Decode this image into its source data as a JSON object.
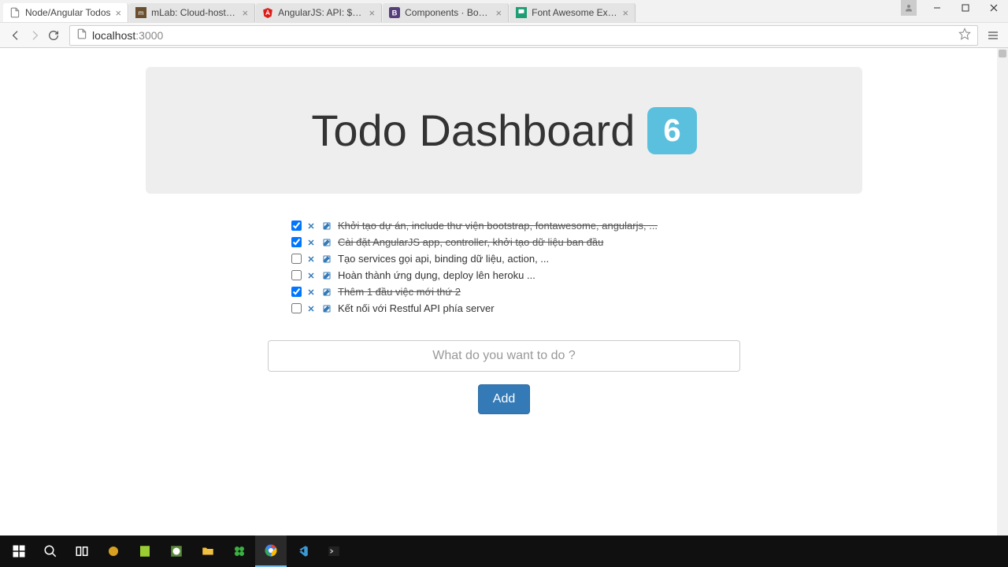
{
  "browser": {
    "tabs": [
      {
        "title": "Node/Angular Todos",
        "favicon": "page",
        "active": true
      },
      {
        "title": "mLab: Cloud-hosted Mon",
        "favicon": "mlab",
        "active": false
      },
      {
        "title": "AngularJS: API: $http",
        "favicon": "angular",
        "active": false
      },
      {
        "title": "Components · Bootstrap",
        "favicon": "bootstrap",
        "active": false
      },
      {
        "title": "Font Awesome Examples",
        "favicon": "fontawesome",
        "active": false
      }
    ],
    "address": {
      "host": "localhost",
      "port": ":3000"
    }
  },
  "jumbo": {
    "title": "Todo Dashboard",
    "count": "6"
  },
  "todos": [
    {
      "done": true,
      "text": "Khởi tạo dự án, include thư viện bootstrap, fontawesome, angularjs, ..."
    },
    {
      "done": true,
      "text": "Cài đặt AngularJS app, controller, khởi tạo dữ liệu ban đầu"
    },
    {
      "done": false,
      "text": "Tạo services gọi api, binding dữ liệu, action, ..."
    },
    {
      "done": false,
      "text": "Hoàn thành ứng dụng, deploy lên heroku ..."
    },
    {
      "done": true,
      "text": "Thêm 1 đầu việc mới thứ 2"
    },
    {
      "done": false,
      "text": "Kết nối với Restful API phía server"
    }
  ],
  "form": {
    "placeholder": "What do you want to do ?",
    "add_label": "Add"
  }
}
